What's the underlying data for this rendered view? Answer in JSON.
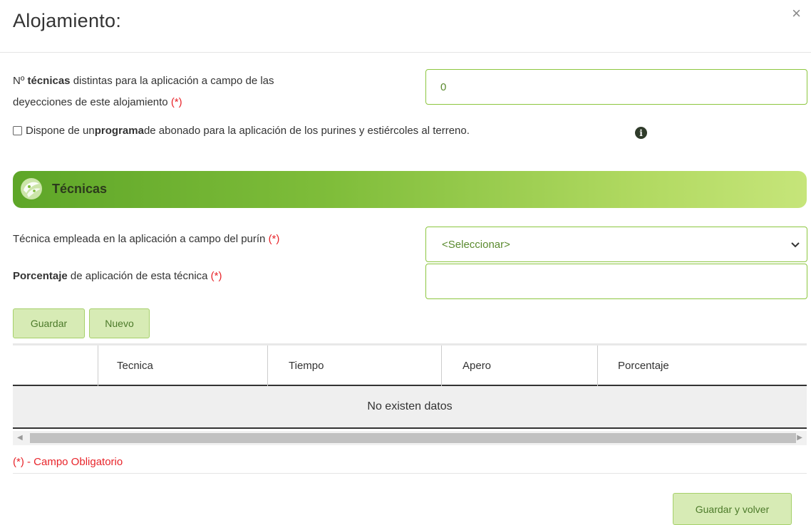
{
  "modal": {
    "title": "Alojamiento:",
    "close_symbol": "×"
  },
  "form": {
    "num_tecnicas": {
      "label_prefix": "Nº ",
      "label_bold": "técnicas",
      "label_line1_rest": " distintas para la aplicación a campo de las",
      "label_line2": "deyecciones de este alojamiento ",
      "required_mark": "(*)",
      "value": "0"
    },
    "programa": {
      "checked": false,
      "text_before": "Dispone de un ",
      "text_bold": "programa",
      "text_after": " de abonado para la aplicación de los purines y estiércoles al terreno.",
      "info_symbol": "i"
    }
  },
  "section": {
    "title": "Técnicas"
  },
  "tecnicas_form": {
    "tecnica": {
      "label": "Técnica empleada en la aplicación a campo del purín ",
      "required_mark": "(*)",
      "selected": "<Seleccionar>"
    },
    "porcentaje": {
      "label_bold": "Porcentaje",
      "label_rest": " de aplicación de esta técnica ",
      "required_mark": "(*)",
      "value": ""
    }
  },
  "buttons": {
    "guardar": "Guardar",
    "nuevo": "Nuevo",
    "guardar_volver": "Guardar y volver"
  },
  "table": {
    "columns": [
      "",
      "Tecnica",
      "Tiempo",
      "Apero",
      "Porcentaje"
    ],
    "empty_message": "No existen datos"
  },
  "footnote": "(*) - Campo Obligatorio",
  "colors": {
    "accent_green": "#8cc63f",
    "button_bg": "#d7ebb5",
    "required_red": "#e8242a"
  }
}
